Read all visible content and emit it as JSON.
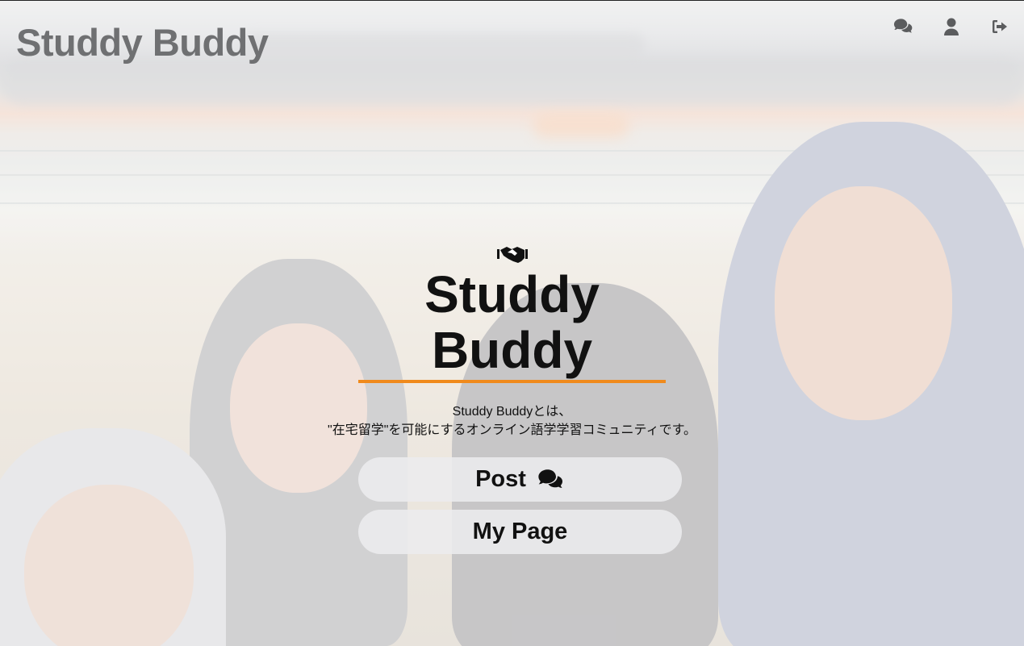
{
  "header": {
    "brand": "Studdy Buddy",
    "nav_icons": [
      "comments-icon",
      "user-icon",
      "sign-out-icon"
    ]
  },
  "hero": {
    "icon": "handshake-icon",
    "title_line1": "Studdy",
    "title_line2": "Buddy",
    "underline_color": "#f08a1c",
    "description_line1": "Studdy Buddyとは、",
    "description_line2": "\"在宅留学\"を可能にするオンライン語学学習コミュニティです。",
    "post_button_label": "Post",
    "post_button_icon": "comments-icon",
    "mypage_button_label": "My Page"
  }
}
